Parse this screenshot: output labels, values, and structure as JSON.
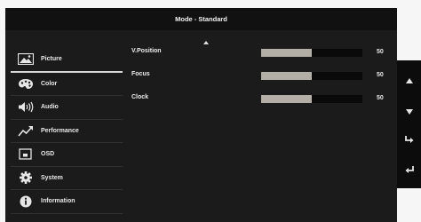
{
  "header": {
    "title": "Mode - Standard"
  },
  "menu": {
    "items": [
      {
        "label": "Picture",
        "icon": "picture-icon",
        "selected": true
      },
      {
        "label": "Color",
        "icon": "palette-icon"
      },
      {
        "label": "Audio",
        "icon": "speaker-icon"
      },
      {
        "label": "Performance",
        "icon": "trend-up-icon"
      },
      {
        "label": "OSD",
        "icon": "osd-icon"
      },
      {
        "label": "System",
        "icon": "gear-icon"
      },
      {
        "label": "Information",
        "icon": "info-icon"
      }
    ]
  },
  "settings": [
    {
      "label": "V.Position",
      "value": "50",
      "level": 0.5
    },
    {
      "label": "Focus",
      "value": "50",
      "level": 0.5
    },
    {
      "label": "Clock",
      "value": "50",
      "level": 0.5
    }
  ],
  "nav_buttons": [
    "up-arrow-icon",
    "down-arrow-icon",
    "enter-icon",
    "back-icon"
  ],
  "colors": {
    "panel": "#1b1b1b",
    "bar_fill": "#b3aea6",
    "bar_track": "#0a0a0a"
  }
}
